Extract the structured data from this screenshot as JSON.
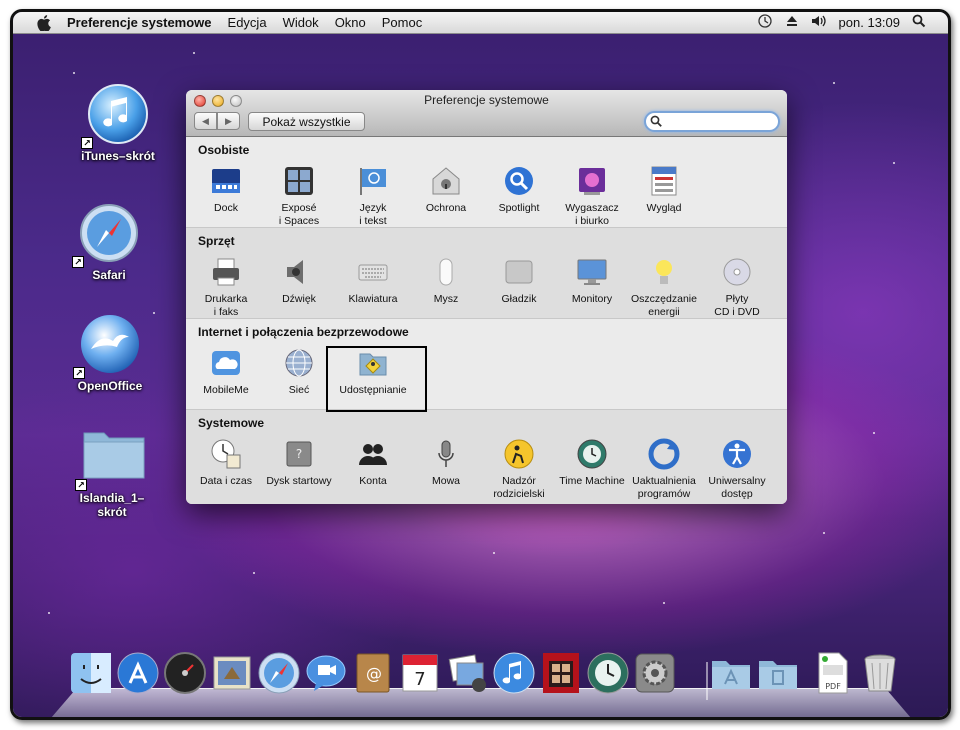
{
  "menubar": {
    "app_name": "Preferencje systemowe",
    "menus": [
      "Edycja",
      "Widok",
      "Okno",
      "Pomoc"
    ],
    "clock": "pon. 13:09"
  },
  "desktop_icons": [
    {
      "label": "iTunes–skrót",
      "icon": "itunes-icon"
    },
    {
      "label": "Safari",
      "icon": "safari-icon"
    },
    {
      "label": "OpenOffice",
      "icon": "openoffice-icon"
    },
    {
      "label": "Islandia_1–skrót",
      "icon": "folder-icon"
    }
  ],
  "window": {
    "title": "Preferencje systemowe",
    "show_all_label": "Pokaż wszystkie",
    "search_value": "",
    "sections": [
      {
        "title": "Osobiste",
        "items": [
          "Dock",
          "Exposé i Spaces",
          "Język i tekst",
          "Ochrona",
          "Spotlight",
          "Wygaszacz i biurko",
          "Wygląd"
        ]
      },
      {
        "title": "Sprzęt",
        "items": [
          "Drukarka i faks",
          "Dźwięk",
          "Klawiatura",
          "Mysz",
          "Gładzik",
          "Monitory",
          "Oszczędzanie energii",
          "Płyty CD i DVD"
        ]
      },
      {
        "title": "Internet i połączenia bezprzewodowe",
        "items": [
          "MobileMe",
          "Sieć",
          "Udostępnianie"
        ]
      },
      {
        "title": "Systemowe",
        "items": [
          "Data i czas",
          "Dysk startowy",
          "Konta",
          "Mowa",
          "Nadzór rodzicielski",
          "Time Machine",
          "Uaktualnienia programów",
          "Uniwersalny dostęp"
        ]
      }
    ],
    "pane_lines": {
      "expose": [
        "Exposé",
        "i Spaces"
      ],
      "jezyk": [
        "Język",
        "i tekst"
      ],
      "wygaszacz": [
        "Wygaszacz",
        "i biurko"
      ],
      "drukarka": [
        "Drukarka",
        "i faks"
      ],
      "oszczedzanie": [
        "Oszczędzanie",
        "energii"
      ],
      "plyty": [
        "Płyty",
        "CD i DVD"
      ],
      "nadzor": [
        "Nadzór",
        "rodzicielski"
      ],
      "uaktualnienia": [
        "Uaktualnienia",
        "programów"
      ],
      "uniwersalny": [
        "Uniwersalny",
        "dostęp"
      ]
    }
  },
  "dock_items": [
    "finder-icon",
    "app-store-icon",
    "dashboard-icon",
    "mail-icon",
    "safari-icon",
    "ichat-icon",
    "address-book-icon",
    "ical-icon",
    "iphoto-icon",
    "itunes-icon",
    "photo-booth-icon",
    "time-machine-icon",
    "system-preferences-icon",
    "applications-folder-icon",
    "documents-folder-icon",
    "pdf-document-icon",
    "trash-icon"
  ],
  "colors": {
    "accent_blue": "#3f7fd6",
    "highlight_border": "#000000"
  },
  "icons": {
    "apple": "apple-logo-icon",
    "menu_extras": [
      "time-machine-icon",
      "eject-icon",
      "volume-icon",
      "spotlight-search-icon"
    ]
  }
}
